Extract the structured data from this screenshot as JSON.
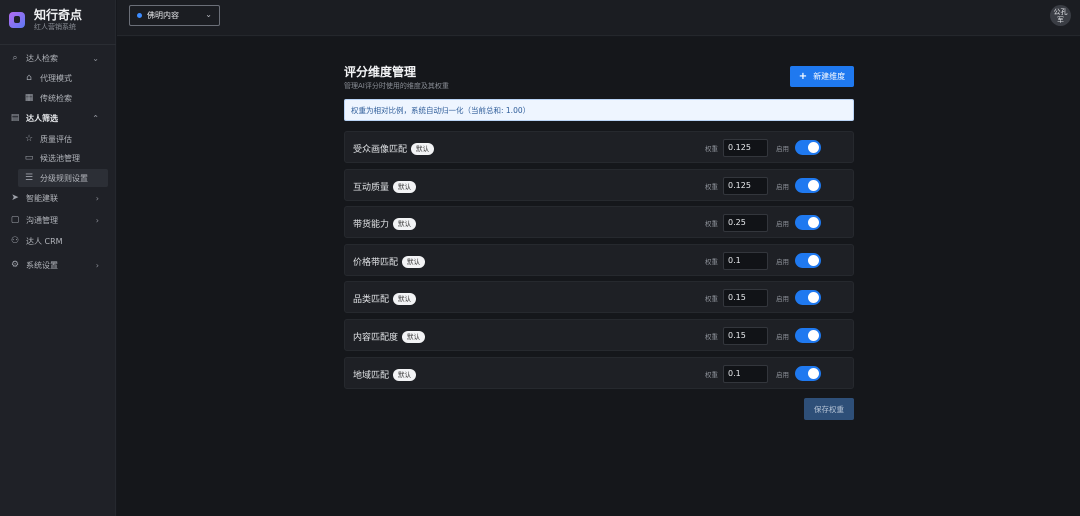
{
  "brand": {
    "title": "知行奇点",
    "subtitle": "红人营销系统"
  },
  "sidebar": {
    "items": [
      {
        "label": "达人检索",
        "icon": "search-icon",
        "chevron": "⌄"
      },
      {
        "label": "代理模式",
        "icon": "home-icon"
      },
      {
        "label": "传统检索",
        "icon": "table-icon"
      },
      {
        "label": "达人筛选",
        "icon": "clipboard-icon",
        "chevron": "⌃"
      },
      {
        "label": "质量评估",
        "icon": "star-icon"
      },
      {
        "label": "候选池管理",
        "icon": "inbox-icon"
      },
      {
        "label": "分级规则设置",
        "icon": "list-icon"
      },
      {
        "label": "智能建联",
        "icon": "send-icon",
        "chevron": "›"
      },
      {
        "label": "沟通管理",
        "icon": "chat-icon",
        "chevron": "›"
      },
      {
        "label": "达人 CRM",
        "icon": "users-icon"
      },
      {
        "label": "系统设置",
        "icon": "gear-icon",
        "chevron": "›"
      }
    ]
  },
  "topbar": {
    "project": "佛明内容",
    "avatar_text": "公孔\n军"
  },
  "main": {
    "title": "评分维度管理",
    "subtitle": "管理AI评分时使用的维度及其权重",
    "new_button": "新建维度",
    "notice": "权重为相对比例，系统自动归一化（当前总和: 1.00）",
    "weight_label": "权重",
    "enable_label": "启用",
    "default_badge": "默认",
    "save_button": "保存权重",
    "dimensions": [
      {
        "name": "受众画像匹配",
        "weight": "0.125",
        "enabled": true
      },
      {
        "name": "互动质量",
        "weight": "0.125",
        "enabled": true
      },
      {
        "name": "带货能力",
        "weight": "0.25",
        "enabled": true
      },
      {
        "name": "价格带匹配",
        "weight": "0.1",
        "enabled": true
      },
      {
        "name": "品类匹配",
        "weight": "0.15",
        "enabled": true
      },
      {
        "name": "内容匹配度",
        "weight": "0.15",
        "enabled": true
      },
      {
        "name": "地域匹配",
        "weight": "0.1",
        "enabled": true
      }
    ]
  },
  "colors": {
    "accent": "#1f79f0",
    "background": "#15171b",
    "sidebar": "#1f2127"
  }
}
